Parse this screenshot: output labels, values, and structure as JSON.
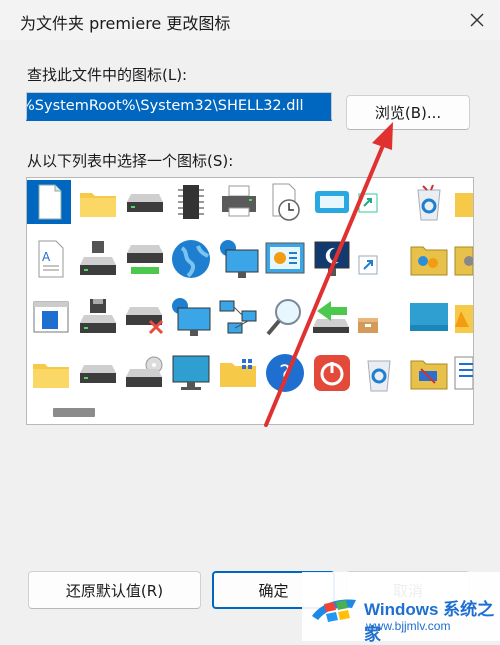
{
  "window": {
    "title": "为文件夹 premiere 更改图标"
  },
  "find_label": "查找此文件中的图标(L):",
  "path_value": "%SystemRoot%\\System32\\SHELL32.dll",
  "browse_label": "浏览(B)...",
  "list_label": "从以下列表中选择一个图标(S):",
  "icons": [
    [
      "blank-document",
      "folder",
      "drive",
      "chip",
      "printer",
      "clock-document",
      "window-card",
      "share-shortcut",
      "recycle-bin-full",
      "folder-partial"
    ],
    [
      "text-document",
      "server-drive",
      "green-drive",
      "globe",
      "network-monitor",
      "presentation-board",
      "moon-monitor",
      "shortcut-arrow",
      "folder-people",
      "folder-gear-partial"
    ],
    [
      "window-sidebar",
      "floppy-drive",
      "drive-error",
      "globe-monitor",
      "network-computers",
      "magnifier",
      "green-back-arrow",
      "box",
      "teal-panel",
      "folder-yellow-partial"
    ],
    [
      "plain-folder",
      "drive-small",
      "cd-drive",
      "monitor",
      "folder-grid",
      "help",
      "power",
      "recycle-bin-empty",
      "folder-tools",
      "sidebar-partial"
    ]
  ],
  "buttons": {
    "restore": "还原默认值(R)",
    "ok": "确定",
    "cancel": "取消"
  },
  "watermark": {
    "title": "Windows 系统之家",
    "url": "www.bjjmlv.com"
  },
  "annotation_color": "#e03030"
}
